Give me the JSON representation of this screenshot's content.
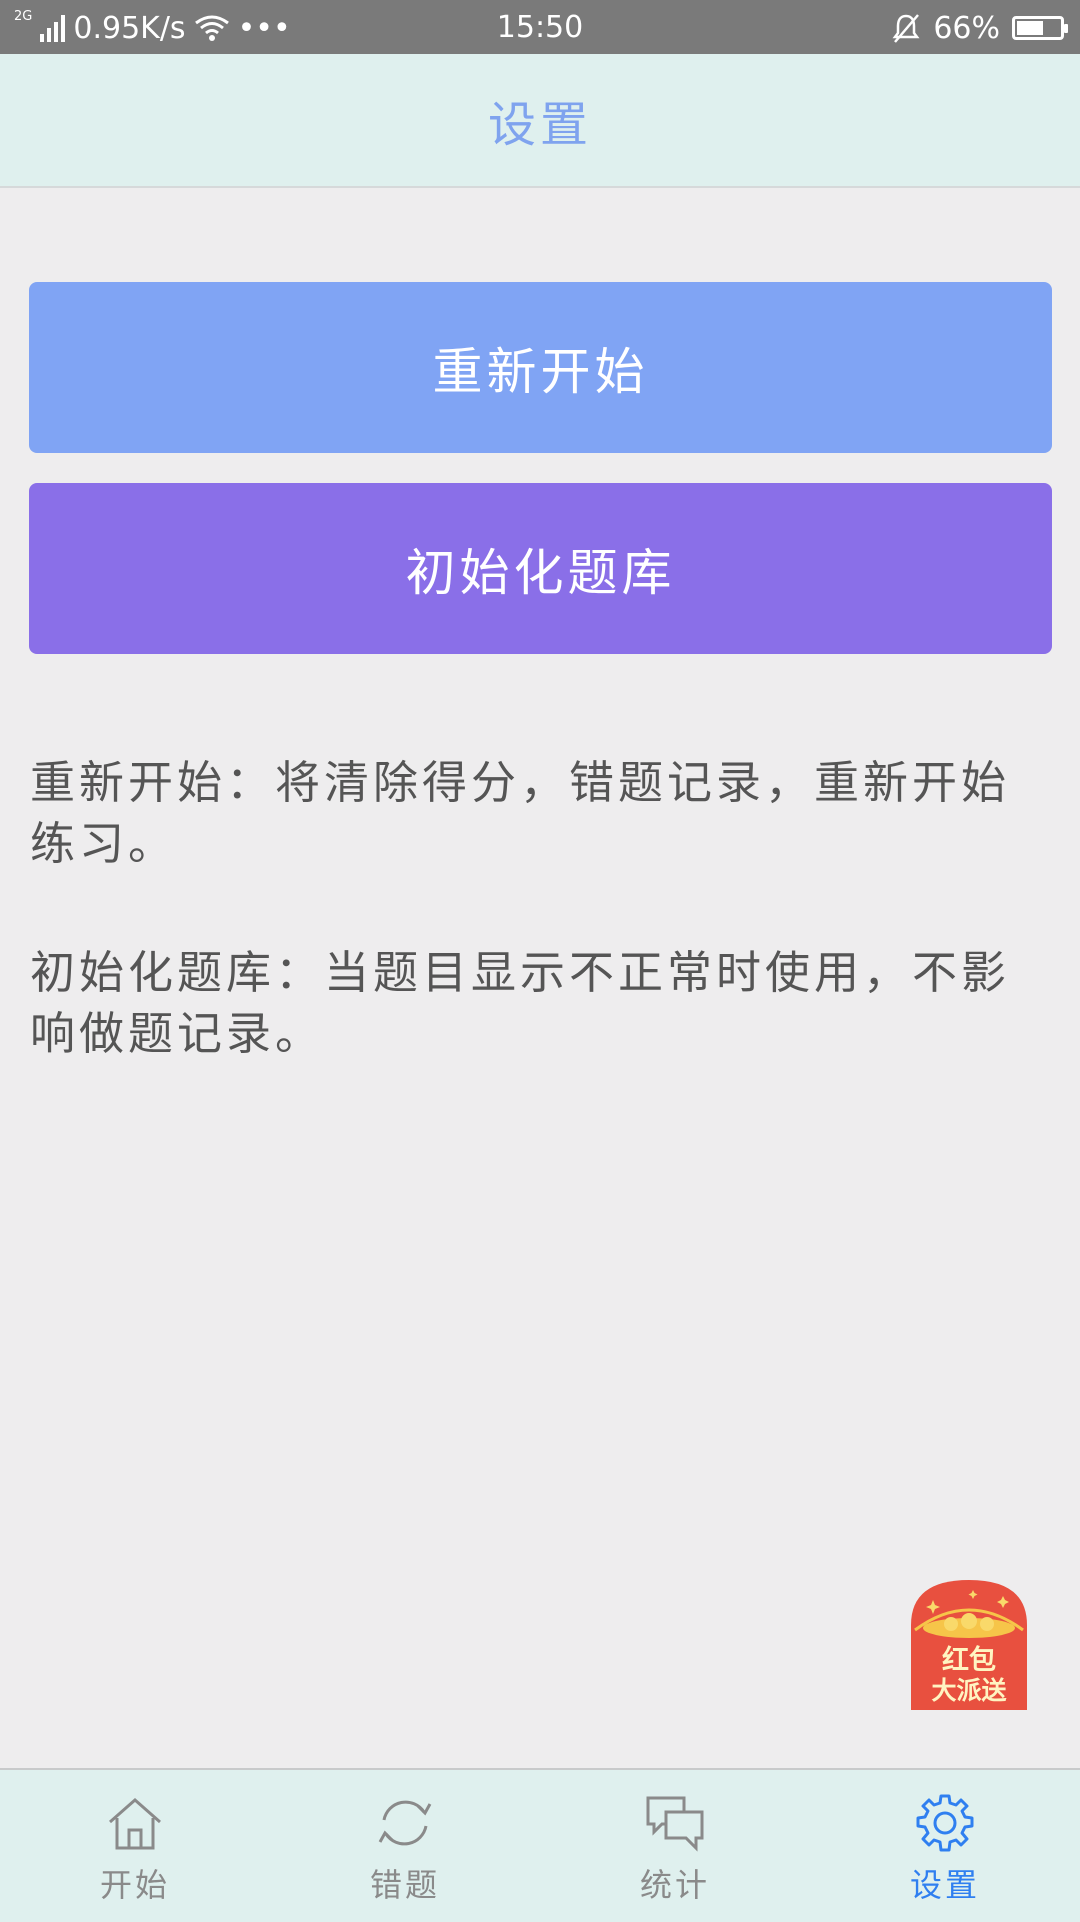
{
  "status_bar": {
    "network_type": "2G",
    "speed": "0.95K/s",
    "more": "•••",
    "time": "15:50",
    "battery_percent": "66%",
    "battery_level": 0.66
  },
  "header": {
    "title": "设置"
  },
  "actions": {
    "restart_label": "重新开始",
    "init_label": "初始化题库"
  },
  "descriptions": {
    "restart": "重新开始：将清除得分，错题记录，重新开始练习。",
    "init": "初始化题库：当题目显示不正常时使用，不影响做题记录。"
  },
  "promo": {
    "line1": "红包",
    "line2": "大派送"
  },
  "bottom_nav": {
    "items": [
      {
        "label": "开始",
        "icon": "home-icon",
        "active": false
      },
      {
        "label": "错题",
        "icon": "refresh-icon",
        "active": false
      },
      {
        "label": "统计",
        "icon": "chat-icon",
        "active": false
      },
      {
        "label": "设置",
        "icon": "gear-icon",
        "active": true
      }
    ]
  },
  "colors": {
    "header_bg": "#dff0ee",
    "title": "#7fa3ee",
    "restart_button": "#80a4f4",
    "init_button": "#8a6fe8",
    "nav_active": "#2f7ff0",
    "nav_inactive": "#8a8a8a"
  }
}
